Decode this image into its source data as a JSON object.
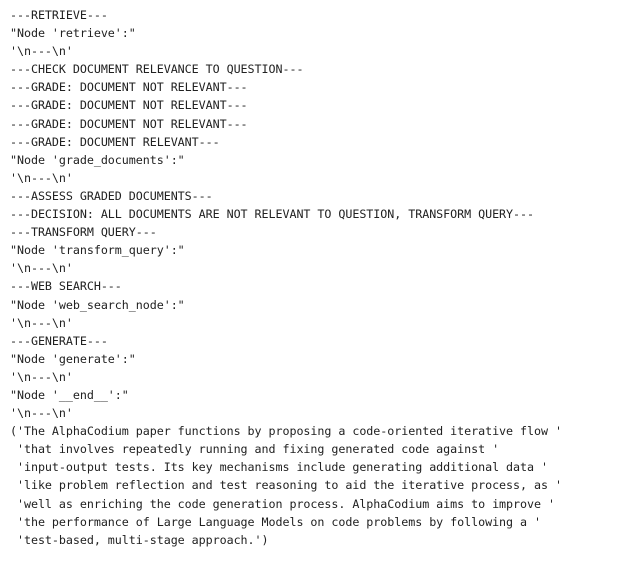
{
  "output": {
    "lines": [
      "---RETRIEVE---",
      "\"Node 'retrieve':\"",
      "'\\n---\\n'",
      "---CHECK DOCUMENT RELEVANCE TO QUESTION---",
      "---GRADE: DOCUMENT NOT RELEVANT---",
      "---GRADE: DOCUMENT NOT RELEVANT---",
      "---GRADE: DOCUMENT NOT RELEVANT---",
      "---GRADE: DOCUMENT RELEVANT---",
      "\"Node 'grade_documents':\"",
      "'\\n---\\n'",
      "---ASSESS GRADED DOCUMENTS---",
      "---DECISION: ALL DOCUMENTS ARE NOT RELEVANT TO QUESTION, TRANSFORM QUERY---",
      "---TRANSFORM QUERY---",
      "\"Node 'transform_query':\"",
      "'\\n---\\n'",
      "---WEB SEARCH---",
      "\"Node 'web_search_node':\"",
      "'\\n---\\n'",
      "---GENERATE---",
      "\"Node 'generate':\"",
      "'\\n---\\n'",
      "\"Node '__end__':\"",
      "'\\n---\\n'",
      "('The AlphaCodium paper functions by proposing a code-oriented iterative flow '",
      " 'that involves repeatedly running and fixing generated code against '",
      " 'input-output tests. Its key mechanisms include generating additional data '",
      " 'like problem reflection and test reasoning to aid the iterative process, as '",
      " 'well as enriching the code generation process. AlphaCodium aims to improve '",
      " 'the performance of Large Language Models on code problems by following a '",
      " 'test-based, multi-stage approach.')"
    ]
  }
}
